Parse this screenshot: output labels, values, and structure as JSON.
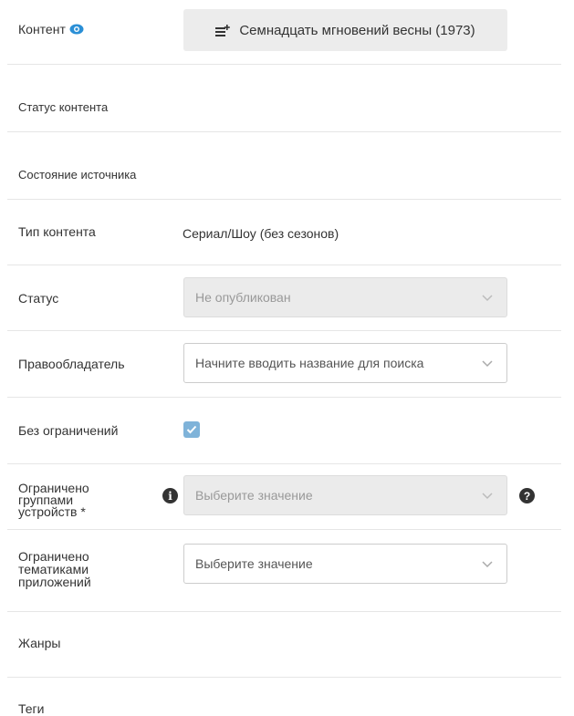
{
  "content": {
    "label": "Контент",
    "button_label": "Семнадцать мгновений весны (1973)"
  },
  "content_status": {
    "label": "Статус контента"
  },
  "source_state": {
    "label": "Состояние источника"
  },
  "content_type": {
    "label": "Тип контента",
    "value": "Сериал/Шоу (без сезонов)"
  },
  "status": {
    "label": "Статус",
    "value": "Не опубликован"
  },
  "rights_holder": {
    "label": "Правообладатель",
    "placeholder": "Начните вводить название для поиска"
  },
  "no_restrictions": {
    "label": "Без ограничений",
    "checked": true
  },
  "device_groups": {
    "label_lines": [
      "Ограничено",
      "группами",
      "устройств *"
    ],
    "placeholder": "Выберите значение",
    "info_icon": "i",
    "help_icon": "?"
  },
  "app_topics": {
    "label_lines": [
      "Ограничено",
      "тематиками",
      "приложений"
    ],
    "placeholder": "Выберите значение"
  },
  "genres": {
    "label": "Жанры"
  },
  "tags": {
    "label": "Теги"
  },
  "colors": {
    "accent": "#2a8fd6",
    "checkbox": "#7fb3d9",
    "disabled_bg": "#ebebeb"
  }
}
